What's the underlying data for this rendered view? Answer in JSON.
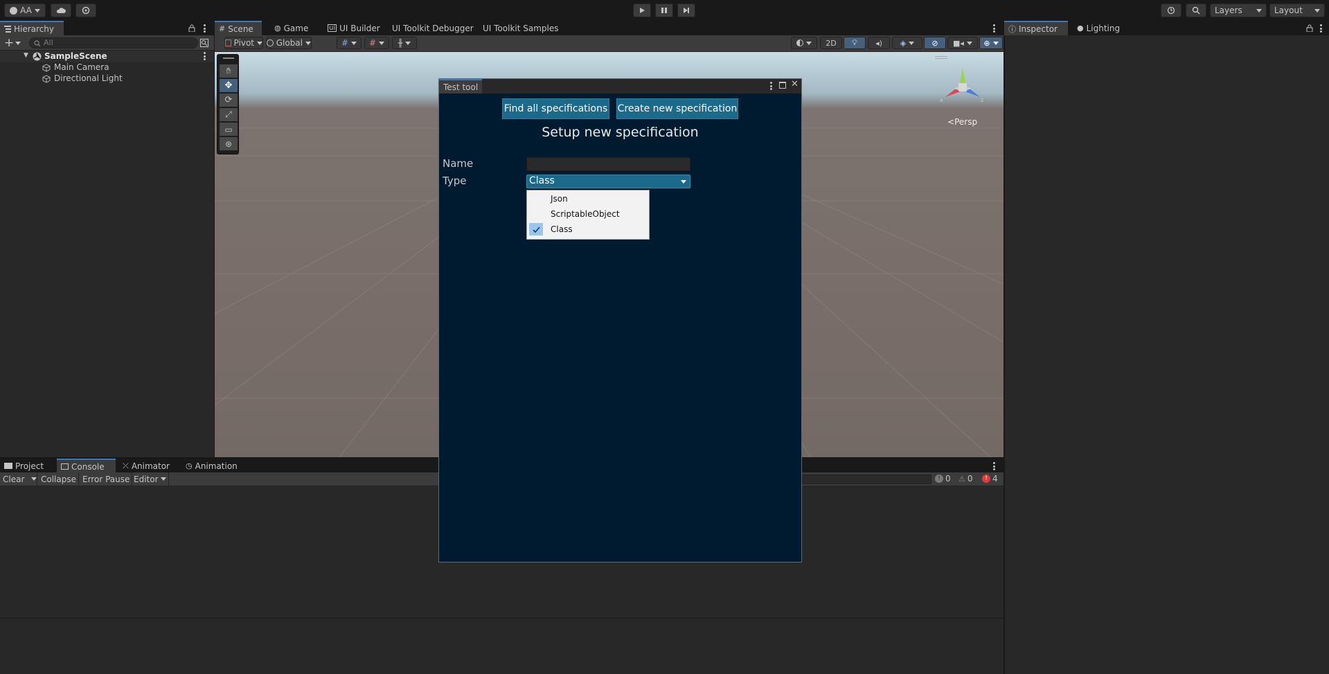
{
  "topbar": {
    "account_label": "AA",
    "layers_label": "Layers",
    "layout_label": "Layout"
  },
  "hierarchy": {
    "tab_label": "Hierarchy",
    "search_placeholder": "All",
    "scene_name": "SampleScene",
    "items": [
      {
        "label": "Main Camera"
      },
      {
        "label": "Directional Light"
      }
    ]
  },
  "scene_tabs": {
    "tabs": [
      {
        "label": "Scene"
      },
      {
        "label": "Game"
      },
      {
        "label": "UI Builder"
      },
      {
        "label": "UI Toolkit Debugger"
      },
      {
        "label": "UI Toolkit Samples"
      }
    ],
    "pivot_label": "Pivot",
    "global_label": "Global",
    "twod_label": "2D",
    "persp_label": "Persp"
  },
  "inspector": {
    "tabs": [
      {
        "label": "Inspector"
      },
      {
        "label": "Lighting"
      }
    ]
  },
  "test_tool": {
    "title": "Test tool",
    "find_button": "Find all specifications",
    "create_button": "Create new specification",
    "heading": "Setup new specification",
    "name_label": "Name",
    "name_value": "",
    "type_label": "Type",
    "type_value": "Class",
    "dropdown_options": [
      {
        "label": "Json",
        "checked": false
      },
      {
        "label": "ScriptableObject",
        "checked": false
      },
      {
        "label": "Class",
        "checked": true
      }
    ]
  },
  "bottom_tabs": {
    "tabs": [
      {
        "label": "Project"
      },
      {
        "label": "Console"
      },
      {
        "label": "Animator"
      },
      {
        "label": "Animation"
      }
    ]
  },
  "console": {
    "clear_label": "Clear",
    "collapse_label": "Collapse",
    "error_pause_label": "Error Pause",
    "editor_label": "Editor",
    "info_count": "0",
    "warning_count": "0",
    "error_count": "4"
  },
  "colors": {
    "accent": "#3a79bb",
    "tool_bg": "#001b2f",
    "tool_button": "#1b6a8c",
    "error_red": "#e03b3b"
  }
}
